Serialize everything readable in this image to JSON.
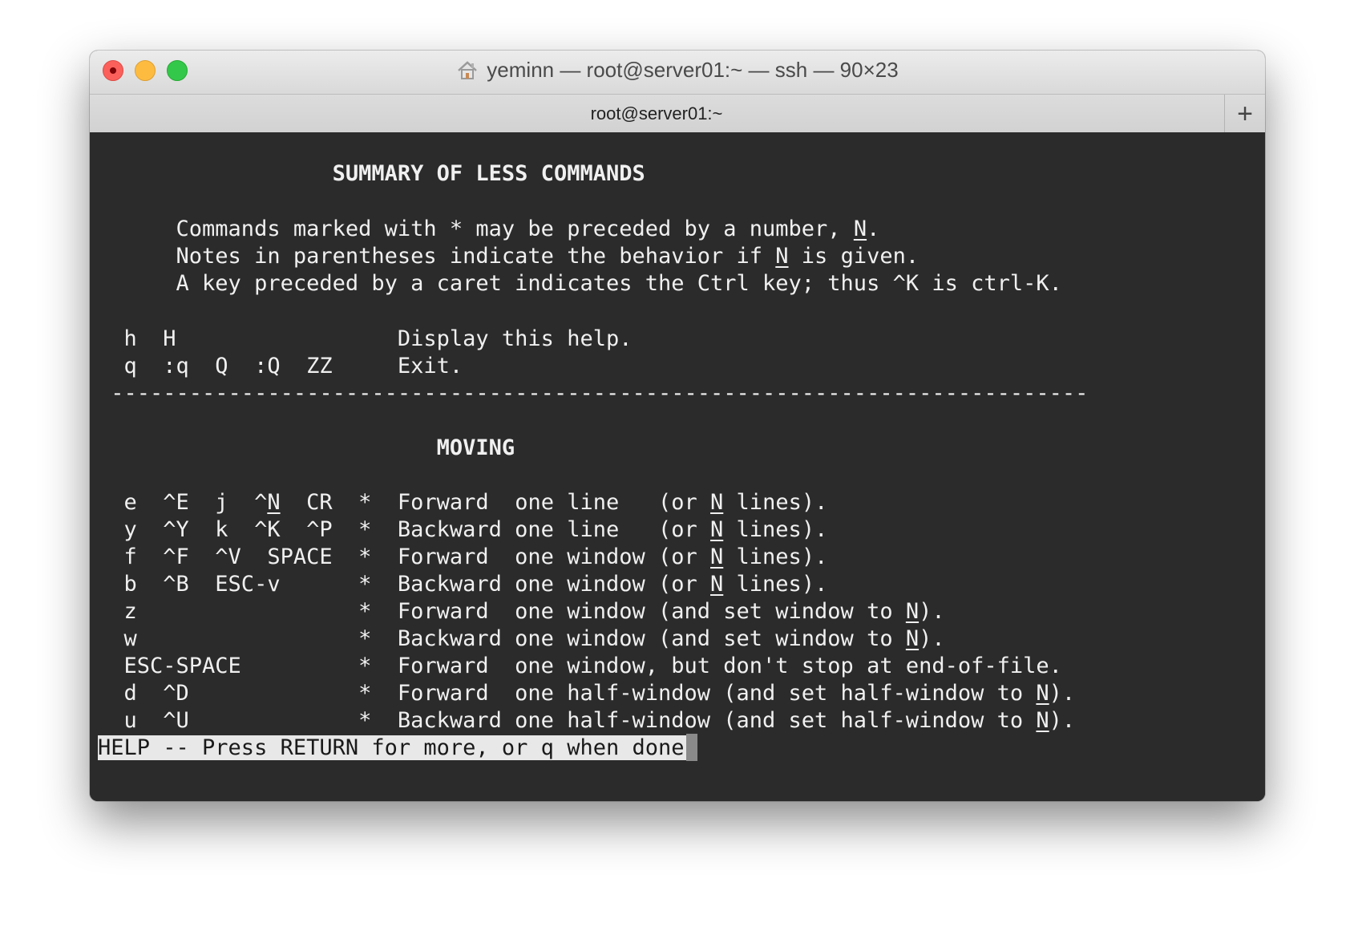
{
  "window": {
    "title": "yeminn — root@server01:~ — ssh — 90×23",
    "tab_label": "root@server01:~",
    "new_tab_label": "+"
  },
  "terminal": {
    "heading": "                  SUMMARY OF LESS COMMANDS",
    "intro": [
      "      Commands marked with * may be preceded by a number, N.",
      "      Notes in parentheses indicate the behavior if N is given.",
      "      A key preceded by a caret indicates the Ctrl key; thus ^K is ctrl-K."
    ],
    "help_lines": [
      "  h  H                 Display this help.",
      "  q  :q  Q  :Q  ZZ     Exit."
    ],
    "separator": " ---------------------------------------------------------------------------",
    "section_title": "                          MOVING",
    "moving_lines": [
      "  e  ^E  j  ^N  CR  *  Forward  one line   (or N lines).",
      "  y  ^Y  k  ^K  ^P  *  Backward one line   (or N lines).",
      "  f  ^F  ^V  SPACE  *  Forward  one window (or N lines).",
      "  b  ^B  ESC-v      *  Backward one window (or N lines).",
      "  z                 *  Forward  one window (and set window to N).",
      "  w                 *  Backward one window (and set window to N).",
      "  ESC-SPACE         *  Forward  one window, but don't stop at end-of-file.",
      "  d  ^D             *  Forward  one half-window (and set half-window to N).",
      "  u  ^U             *  Backward one half-window (and set half-window to N)."
    ],
    "status_prompt": "HELP -- Press RETURN for more, or q when done"
  },
  "colors": {
    "terminal_bg": "#2b2b2b",
    "terminal_fg": "#f0f0f0",
    "close": "#fc605b",
    "minimize": "#fdbc40",
    "zoom": "#34c84a"
  },
  "icons": [
    "close-button",
    "minimize-button",
    "zoom-button",
    "home-icon",
    "new-tab-plus-icon"
  ]
}
